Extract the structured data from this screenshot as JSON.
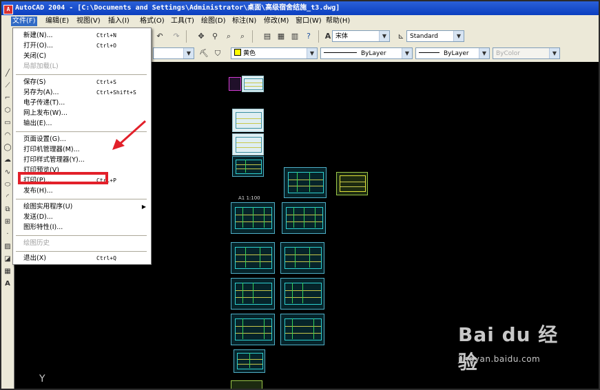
{
  "window": {
    "title": "AutoCAD 2004 - [C:\\Documents and Settings\\Administrator\\桌面\\高级宿舍结施_t3.dwg]"
  },
  "menubar": {
    "items": [
      "文件(F)",
      "编辑(E)",
      "视图(V)",
      "插入(I)",
      "格式(O)",
      "工具(T)",
      "绘图(D)",
      "标注(N)",
      "修改(M)",
      "窗口(W)",
      "帮助(H)"
    ]
  },
  "toolbar": {
    "font_value": "宋体",
    "style_value": "Standard",
    "color_value": "黄色",
    "linetype_value": "ByLayer",
    "lineweight_value": "ByLayer",
    "plotstyle_value": "ByColor"
  },
  "file_menu": {
    "items": [
      {
        "label": "新建(N)...",
        "shortcut": "Ctrl+N"
      },
      {
        "label": "打开(O)...",
        "shortcut": "Ctrl+O"
      },
      {
        "label": "关闭(C)",
        "shortcut": ""
      },
      {
        "label": "局部加载(L)",
        "shortcut": ""
      },
      {
        "label": "保存(S)",
        "shortcut": "Ctrl+S"
      },
      {
        "label": "另存为(A)...",
        "shortcut": "Ctrl+Shift+S"
      },
      {
        "label": "电子传递(T)...",
        "shortcut": ""
      },
      {
        "label": "网上发布(W)...",
        "shortcut": ""
      },
      {
        "label": "输出(E)...",
        "shortcut": ""
      },
      {
        "label": "页面设置(G)...",
        "shortcut": ""
      },
      {
        "label": "打印机管理器(M)...",
        "shortcut": ""
      },
      {
        "label": "打印样式管理器(Y)...",
        "shortcut": ""
      },
      {
        "label": "打印预览(V)",
        "shortcut": ""
      },
      {
        "label": "打印(P)...",
        "shortcut": "Ctrl+P"
      },
      {
        "label": "发布(H)...",
        "shortcut": ""
      },
      {
        "label": "绘图实用程序(U)",
        "shortcut": ""
      },
      {
        "label": "发送(D)...",
        "shortcut": ""
      },
      {
        "label": "图形特性(I)...",
        "shortcut": ""
      },
      {
        "label": "绘图历史",
        "shortcut": ""
      },
      {
        "label": "退出(X)",
        "shortcut": "Ctrl+Q"
      }
    ]
  },
  "canvas": {
    "sheet_label": "A1 1:100",
    "ucs_y": "Y"
  },
  "watermark": {
    "logo": "Bai du 经验",
    "url": "jingyan.baidu.com"
  },
  "colors": {
    "highlight": "#e2202a",
    "accent": "#316ac5",
    "sheet_border": "#4fb0c8"
  }
}
